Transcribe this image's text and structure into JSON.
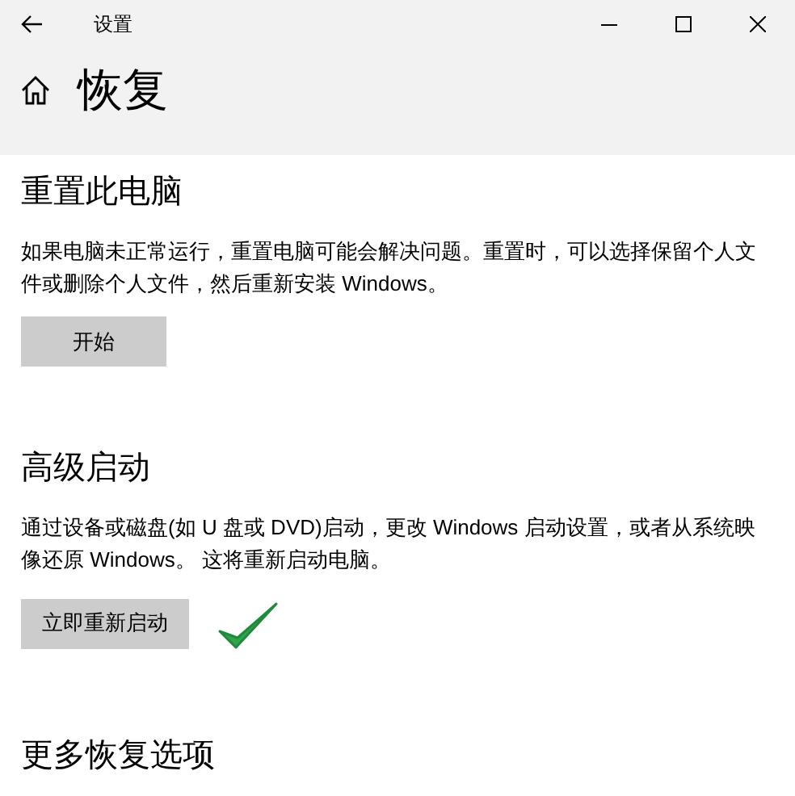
{
  "window": {
    "title": "设置"
  },
  "page": {
    "title": "恢复"
  },
  "sections": [
    {
      "title": "重置此电脑",
      "description": "如果电脑未正常运行，重置电脑可能会解决问题。重置时，可以选择保留个人文件或删除个人文件，然后重新安装 Windows。",
      "button": "开始"
    },
    {
      "title": "高级启动",
      "description": "通过设备或磁盘(如 U 盘或 DVD)启动，更改 Windows 启动设置，或者从系统映像还原 Windows。 这将重新启动电脑。",
      "button": "立即重新启动"
    },
    {
      "title": "更多恢复选项"
    }
  ]
}
